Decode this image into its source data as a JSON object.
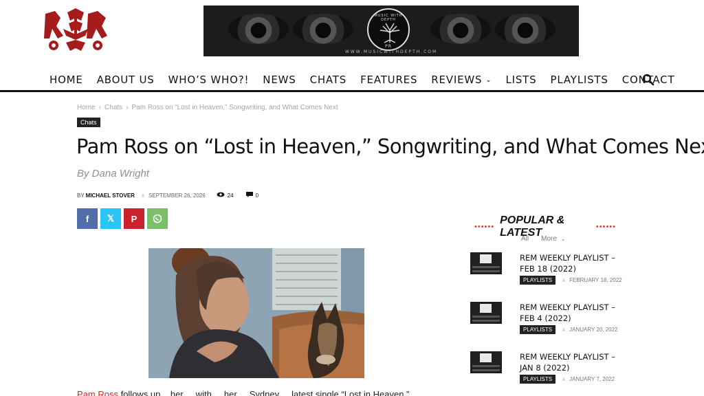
{
  "nav": {
    "items": [
      "HOME",
      "ABOUT US",
      "WHO’S WHO?!",
      "NEWS",
      "CHATS",
      "FEATURES",
      "REVIEWS",
      "LISTS",
      "PLAYLISTS",
      "CONTACT"
    ]
  },
  "banner": {
    "badge_text": "MUSIC WITH DEPTH",
    "badge_initials": "PR",
    "url": "WWW.MUSICWITHDEPTH.COM"
  },
  "breadcrumb": [
    "Home",
    "Chats",
    "Pam Ross on “Lost in Heaven,” Songwriting, and What Comes Next"
  ],
  "article": {
    "category": "Chats",
    "title": "Pam Ross on “Lost in Heaven,” Songwriting, and What Comes Next",
    "subtitle": "By Dana Wright",
    "meta": {
      "by_label": "BY",
      "author": "MICHAEL STOVER",
      "separator": "x",
      "date": "SEPTEMBER 26, 2026",
      "views": "24",
      "comments": "0"
    },
    "first_line_lead": "Pam Ross",
    "first_line_rest": " follows up... her ... with ... her ... Sydney ... latest single “Lost in Heaven,” ... "
  },
  "share": {
    "twitter_glyph": "𝕏"
  },
  "sidebar": {
    "title": "POPULAR & LATEST",
    "dots": "••••••",
    "filters": {
      "all": "All",
      "more": "More"
    },
    "posts": [
      {
        "title": "REM WEEKLY PLAYLIST – FEB 18 (2022)",
        "tag": "PLAYLISTS",
        "date": "FEBRUARY 18, 2022"
      },
      {
        "title": "REM WEEKLY PLAYLIST – FEB 4 (2022)",
        "tag": "PLAYLISTS",
        "date": "JANUARY 20, 2022"
      },
      {
        "title": "REM WEEKLY PLAYLIST – JAN 8 (2022)",
        "tag": "PLAYLISTS",
        "date": "JANUARY 7, 2022"
      }
    ]
  },
  "colors": {
    "accent_red": "#d6261f",
    "logo_red": "#a61b1b",
    "facebook": "#516eab",
    "twitter": "#29c5f6",
    "pinterest": "#ca212a",
    "whatsapp": "#7bbf6a"
  }
}
